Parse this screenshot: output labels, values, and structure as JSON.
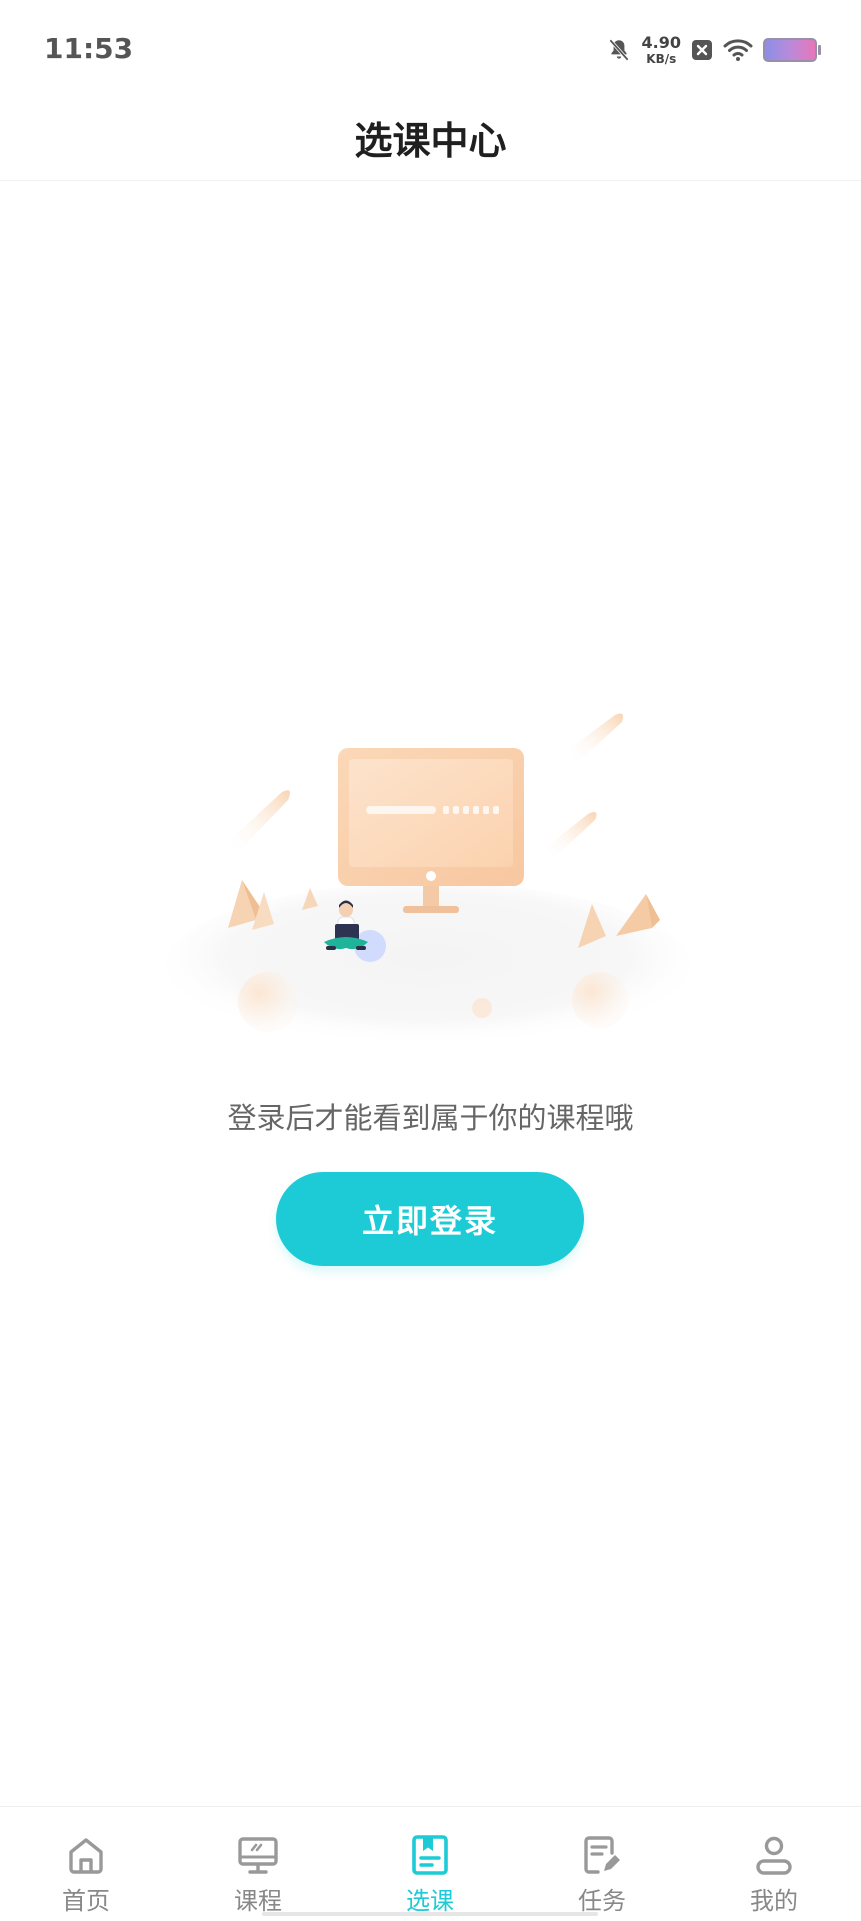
{
  "status_bar": {
    "time": "11:53",
    "net_speed_value": "4.90",
    "net_speed_unit": "KB/s",
    "icons": [
      "bell-muted-icon",
      "close-box-icon",
      "wifi-icon",
      "battery-icon"
    ]
  },
  "header": {
    "title": "选课中心"
  },
  "empty_state": {
    "illustration": "computer-desk-illustration",
    "message": "登录后才能看到属于你的课程哦",
    "login_button": "立即登录"
  },
  "tab_bar": {
    "active_index": 2,
    "active_color": "#1ccbd5",
    "items": [
      {
        "label": "首页",
        "icon": "home-icon"
      },
      {
        "label": "课程",
        "icon": "monitor-icon"
      },
      {
        "label": "选课",
        "icon": "bookmark-book-icon"
      },
      {
        "label": "任务",
        "icon": "task-edit-icon"
      },
      {
        "label": "我的",
        "icon": "person-icon"
      }
    ]
  }
}
